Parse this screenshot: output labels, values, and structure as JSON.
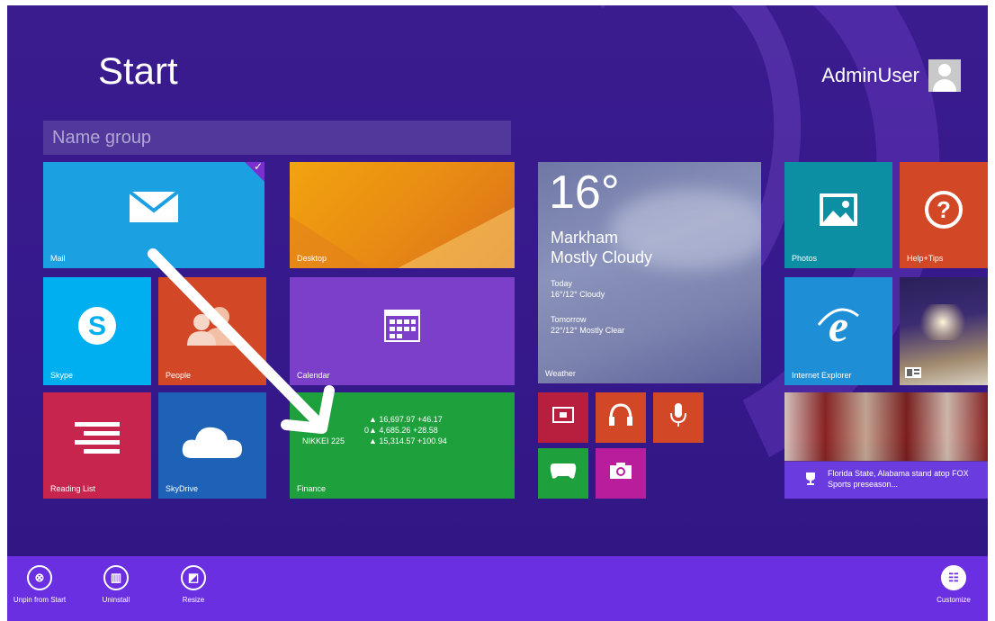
{
  "page": {
    "title": "Start"
  },
  "user": {
    "name": "AdminUser",
    "icon": "user-avatar-icon"
  },
  "group": {
    "placeholder": "Name group"
  },
  "tiles": {
    "mail": {
      "label": "Mail",
      "icon": "mail-icon",
      "color": "#1ba1e2"
    },
    "desktop": {
      "label": "Desktop"
    },
    "skype": {
      "label": "Skype",
      "icon": "skype-icon",
      "color": "#00aff0"
    },
    "people": {
      "label": "People",
      "icon": "people-icon",
      "color": "#d24726"
    },
    "calendar": {
      "label": "Calendar",
      "icon": "calendar-icon",
      "color": "#7b3fc9"
    },
    "reading": {
      "label": "Reading List",
      "icon": "reading-list-icon",
      "color": "#c7254e"
    },
    "skydrive": {
      "label": "SkyDrive",
      "icon": "cloud-icon",
      "color": "#1e62b8"
    },
    "finance": {
      "label": "Finance",
      "color": "#1ea03c",
      "rows": [
        {
          "name": "",
          "value": "▲ 16,697.97 +46.17"
        },
        {
          "name": "0",
          "value": "▲ 4,685.26 +28.58"
        },
        {
          "name": "NIKKEI 225",
          "value": "▲ 15,314.57 +100.94"
        }
      ]
    },
    "weather": {
      "label": "Weather",
      "temp": "16°",
      "city": "Markham",
      "cond": "Mostly Cloudy",
      "today_label": "Today",
      "today": "16°/12° Cloudy",
      "tomorrow_label": "Tomorrow",
      "tomorrow": "22°/12° Mostly Clear"
    },
    "photos": {
      "label": "Photos",
      "icon": "photos-icon",
      "color": "#0c8fa3"
    },
    "help": {
      "label": "Help+Tips",
      "icon": "help-icon",
      "color": "#d24726"
    },
    "ie": {
      "label": "Internet Explorer",
      "icon": "internet-explorer-icon",
      "color": "#1e8fd6"
    },
    "news": {
      "icon": "news-icon"
    },
    "sports": {
      "headline": "Florida State, Alabama stand atop FOX Sports preseason...",
      "icon": "trophy-icon"
    },
    "small": [
      {
        "icon": "video-icon",
        "color": "#b81e3d"
      },
      {
        "icon": "music-headphones-icon",
        "color": "#d24726"
      },
      {
        "icon": "microphone-icon",
        "color": "#d24726"
      },
      {
        "icon": "games-controller-icon",
        "color": "#1ea03c"
      },
      {
        "icon": "camera-icon",
        "color": "#b81e9b"
      }
    ]
  },
  "appbar": {
    "unpin": "Unpin from Start",
    "uninstall": "Uninstall",
    "resize": "Resize",
    "customize": "Customize"
  }
}
